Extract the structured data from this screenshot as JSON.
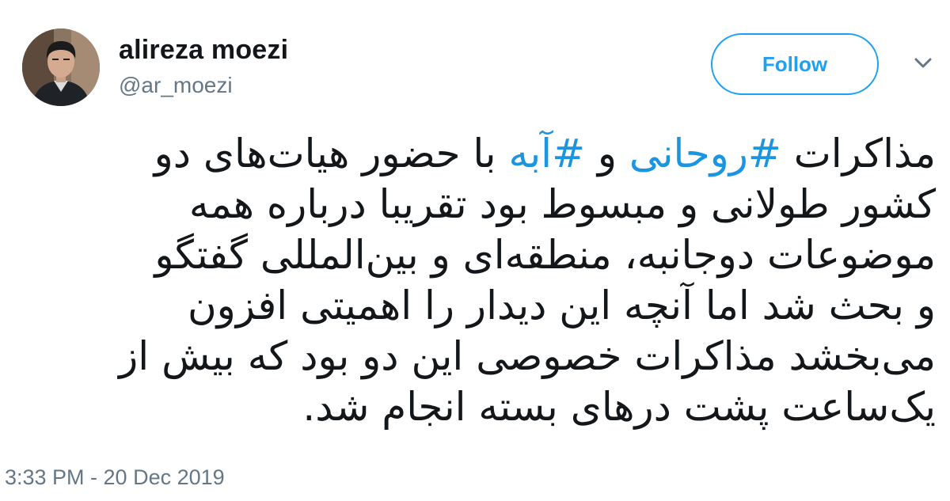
{
  "user": {
    "display_name": "alireza moezi",
    "handle": "@ar_moezi"
  },
  "actions": {
    "follow_label": "Follow",
    "more_icon": "chevron-down-icon"
  },
  "tweet": {
    "line1_a": "مذاکرات ",
    "hashtag1": "#روحانی",
    "line1_b": " و ",
    "hashtag2": "#آبه",
    "line1_c": " با حضور هیات‌های دو",
    "line2": "کشور طولانی و مبسوط بود تقریبا درباره همه",
    "line3": "موضوعات دوجانبه، منطقه‌ای و بین‌المللی گفتگو",
    "line4": "و بحث شد اما آنچه این دیدار را اهمیتی افزون",
    "line5": "می‌بخشد مذاکرات خصوصی این دو بود که بیش از",
    "line6": "یک‌ساعت پشت درهای بسته انجام شد."
  },
  "timestamp": "3:33 PM - 20 Dec 2019",
  "colors": {
    "accent": "#1da1f2",
    "hashtag": "#1b95e0",
    "text": "#14171a",
    "muted": "#657786"
  }
}
